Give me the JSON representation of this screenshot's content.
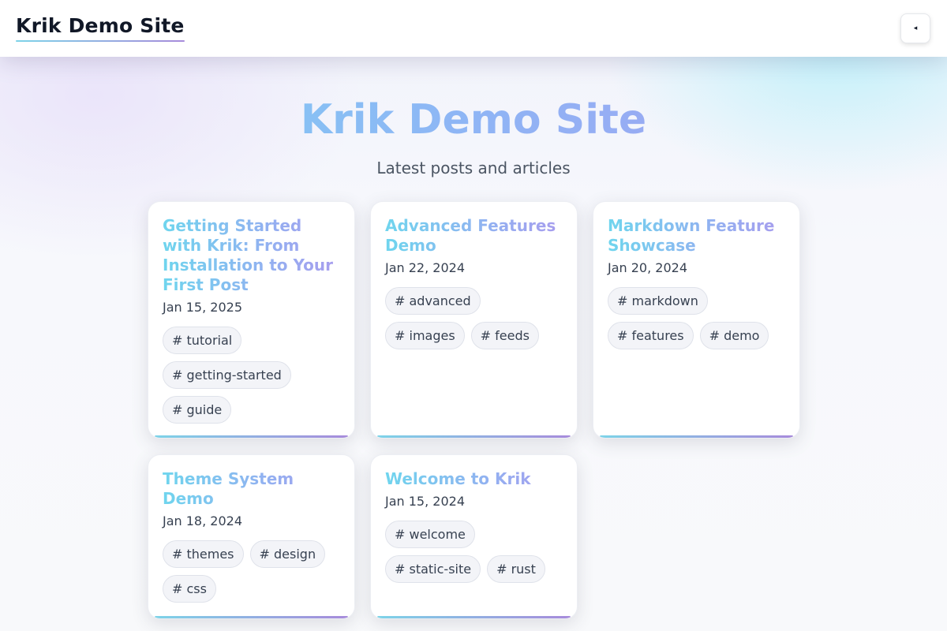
{
  "header": {
    "site_title": "Krik Demo Site",
    "theme_toggle_icon": "◂"
  },
  "hero": {
    "title": "Krik Demo Site",
    "subtitle": "Latest posts and articles"
  },
  "posts": [
    {
      "title": "Getting Started with Krik: From Installation to Your First Post",
      "date": "Jan 15, 2025",
      "tags": [
        "# tutorial",
        "# getting-started",
        "# guide"
      ]
    },
    {
      "title": "Advanced Features Demo",
      "date": "Jan 22, 2024",
      "tags": [
        "# advanced",
        "# images",
        "# feeds"
      ]
    },
    {
      "title": "Markdown Feature Showcase",
      "date": "Jan 20, 2024",
      "tags": [
        "# markdown",
        "# features",
        "# demo"
      ]
    },
    {
      "title": "Theme System Demo",
      "date": "Jan 18, 2024",
      "tags": [
        "# themes",
        "# design",
        "# css"
      ]
    },
    {
      "title": "Welcome to Krik",
      "date": "Jan 15, 2024",
      "tags": [
        "# welcome",
        "# static-site",
        "# rust"
      ]
    }
  ],
  "colors": {
    "accent_start": "#7dd3e8",
    "accent_end": "#a78bdb"
  }
}
